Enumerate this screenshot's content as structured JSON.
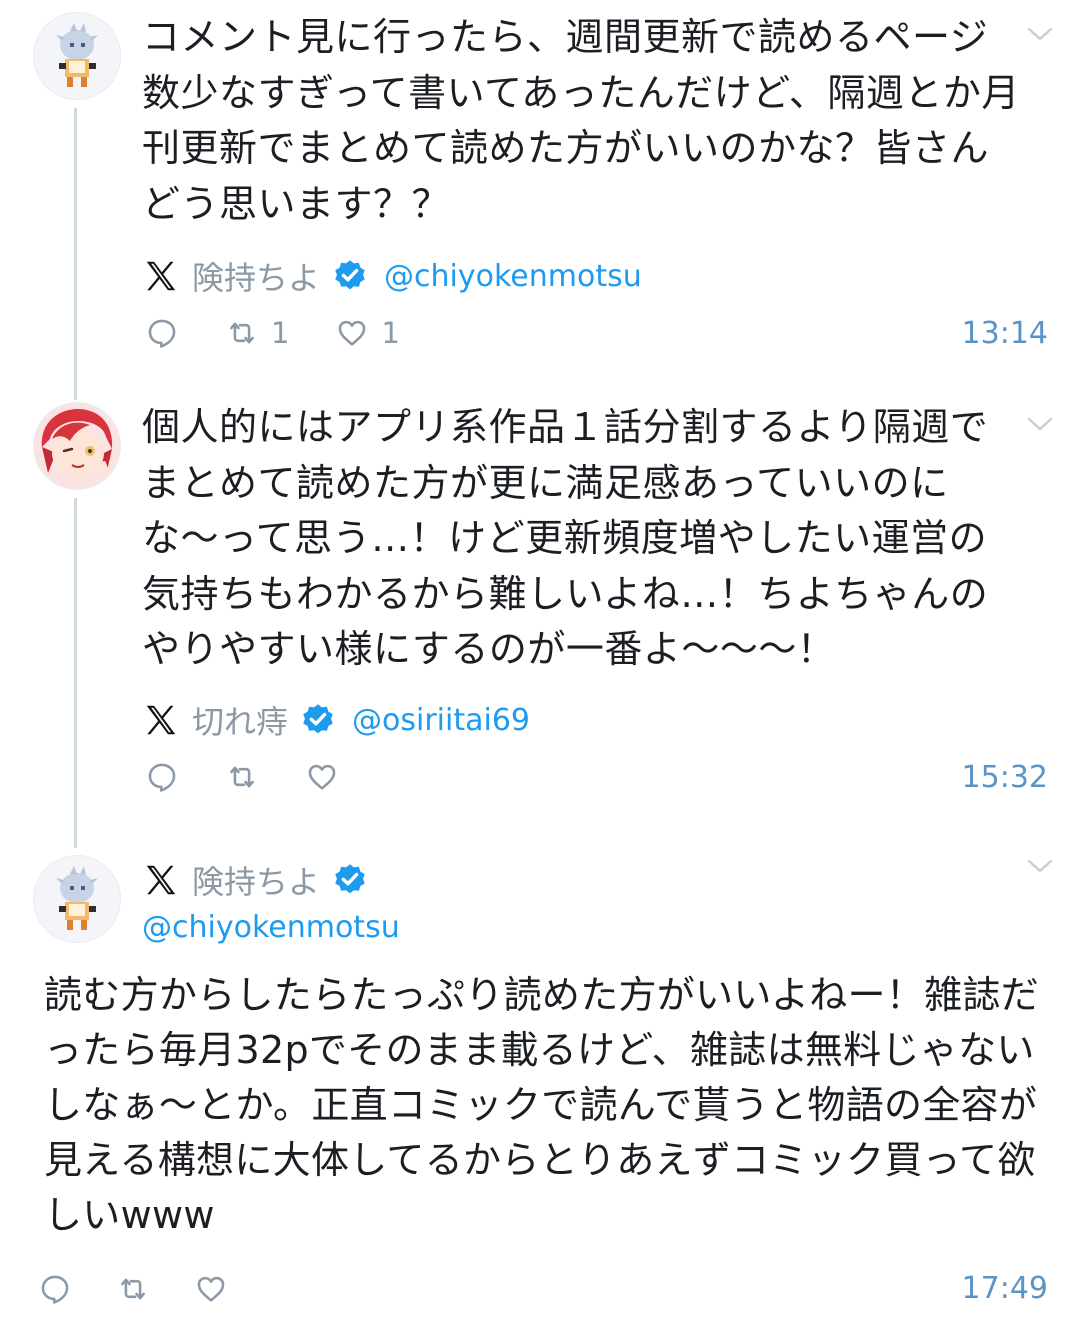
{
  "tweets": [
    {
      "display_name": "険持ちよ",
      "handle": "@chiyokenmotsu",
      "text": "コメント見に行ったら、週間更新で読めるページ数少なすぎって書いてあったんだけど、隔週とか月刊更新でまとめて読めた方がいいのかな？皆さんどう思います？？",
      "retweets": "1",
      "likes": "1",
      "time": "13:14"
    },
    {
      "display_name": "切れ痔",
      "handle": "@osiriitai69",
      "text": "個人的にはアプリ系作品１話分割するより隔週でまとめて読めた方が更に満足感あっていいのにな〜って思う…！けど更新頻度増やしたい運営の気持ちもわかるから難しいよね…！ちよちゃんのやりやすい様にするのが一番よ〜〜〜！",
      "time": "15:32"
    },
    {
      "display_name": "険持ちよ",
      "handle": "@chiyokenmotsu",
      "text": "読む方からしたらたっぷり読めた方がいいよねー！雑誌だったら毎月32pでそのまま載るけど、雑誌は無料じゃないしなぁ〜とか。正直コミックで読んで貰うと物語の全容が見える構想に大体してるからとりあえずコミック買って欲しいwww",
      "time": "17:49"
    }
  ],
  "icons": {
    "platform": "x-logo-icon",
    "verified": "verified-badge-icon",
    "reply": "reply-icon",
    "retweet": "retweet-icon",
    "like": "heart-icon",
    "menu": "chevron-down-icon"
  },
  "colors": {
    "handle": "#1d9bf0",
    "verified": "#1d9bf0",
    "muted": "#8b98a5",
    "time": "#5a94c8",
    "thread_line": "#cfd9de"
  }
}
